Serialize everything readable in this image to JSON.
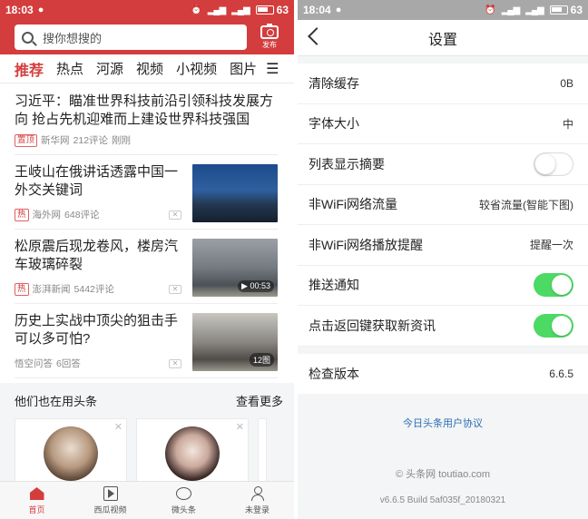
{
  "left": {
    "status": {
      "time": "18:03",
      "battery": "63"
    },
    "search": {
      "placeholder": "搜你想搜的"
    },
    "publish_label": "发布",
    "tabs": [
      {
        "label": "推荐",
        "active": true
      },
      {
        "label": "热点"
      },
      {
        "label": "河源"
      },
      {
        "label": "视频"
      },
      {
        "label": "小视频"
      },
      {
        "label": "图片"
      }
    ],
    "feed": [
      {
        "headline": "习近平：瞄准世界科技前沿引领科技发展方向 抢占先机迎难而上建设世界科技强国",
        "tag": "置顶",
        "source": "新华网",
        "comments": "212评论",
        "time": "刚刚"
      },
      {
        "headline": "王岐山在俄讲话透露中国一外交关键词",
        "tag": "热",
        "source": "海外网",
        "comments": "648评论"
      },
      {
        "headline": "松原震后现龙卷风，楼房汽车玻璃碎裂",
        "tag": "热",
        "source": "澎湃新闻",
        "comments": "5442评论",
        "duration": "00:53"
      },
      {
        "headline": "历史上实战中顶尖的狙击手可以多可怕?",
        "source": "悟空问答",
        "comments": "6回答",
        "photo_count": "12图"
      }
    ],
    "also": {
      "title": "他们也在用头条",
      "more": "查看更多"
    },
    "bottom_nav": [
      {
        "label": "首页",
        "active": true
      },
      {
        "label": "西瓜视频"
      },
      {
        "label": "微头条"
      },
      {
        "label": "未登录"
      }
    ]
  },
  "right": {
    "status": {
      "time": "18:04",
      "battery": "63"
    },
    "title": "设置",
    "settings": [
      {
        "label": "清除缓存",
        "value": "0B"
      },
      {
        "label": "字体大小",
        "value": "中"
      },
      {
        "label": "列表显示摘要",
        "toggle": false
      },
      {
        "label": "非WiFi网络流量",
        "value": "较省流量(智能下图)"
      },
      {
        "label": "非WiFi网络播放提醒",
        "value": "提醒一次"
      },
      {
        "label": "推送通知",
        "toggle": true
      },
      {
        "label": "点击返回键获取新资讯",
        "toggle": true
      }
    ],
    "version": {
      "label": "检查版本",
      "value": "6.6.5"
    },
    "agreement": "今日头条用户协议",
    "copyright": "© 头条网 toutiao.com",
    "build": "v6.6.5 Build 5af035f_20180321"
  },
  "colors": {
    "brand_red": "#d43d3d",
    "toggle_green": "#4cd964",
    "link_blue": "#2a6db5"
  }
}
